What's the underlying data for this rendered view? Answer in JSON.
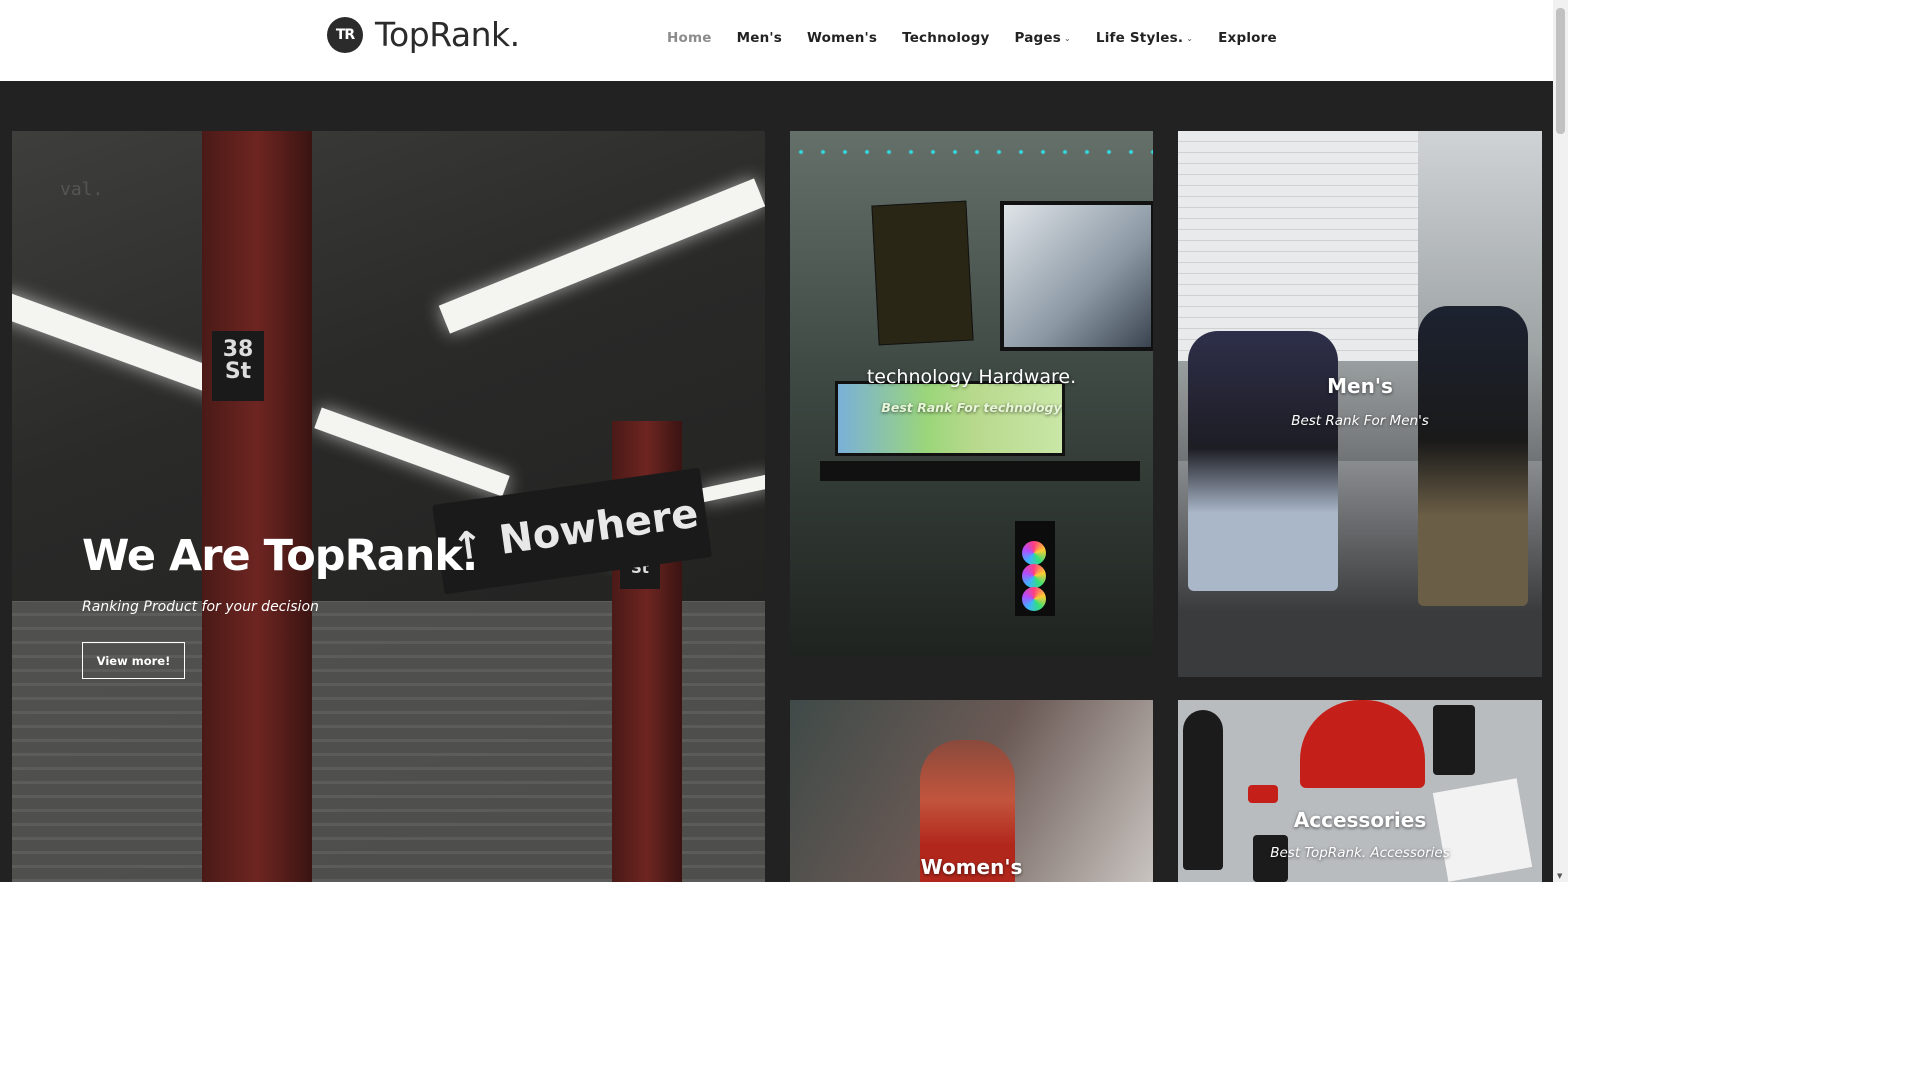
{
  "brand": {
    "logo_mark": "TR",
    "name": "TopRank."
  },
  "nav": {
    "items": [
      {
        "label": "Home",
        "active": true,
        "dropdown": false
      },
      {
        "label": "Men's",
        "active": false,
        "dropdown": false
      },
      {
        "label": "Women's",
        "active": false,
        "dropdown": false
      },
      {
        "label": "Technology",
        "active": false,
        "dropdown": false
      },
      {
        "label": "Pages",
        "active": false,
        "dropdown": true
      },
      {
        "label": "Life Styles.",
        "active": false,
        "dropdown": true
      },
      {
        "label": "Explore",
        "active": false,
        "dropdown": false
      }
    ]
  },
  "hero": {
    "title": "We Are TopRank.",
    "subtitle": "Ranking Product for your decision",
    "button_label": "View more!",
    "scene_sign": "Nowhere",
    "scene_plate_1": "38\nSt",
    "scene_plate_2": "38\nSt",
    "scene_text": "val."
  },
  "cards": {
    "technology": {
      "title": "technology Hardware.",
      "subtitle": "Best Rank For technology"
    },
    "mens": {
      "title": "Men's",
      "subtitle": "Best Rank For Men's"
    },
    "womens": {
      "title": "Women's"
    },
    "accessories": {
      "title": "Accessories",
      "subtitle": "Best TopRank. Accessories"
    }
  },
  "colors": {
    "header_bg": "#ffffff",
    "page_bg": "#222222",
    "nav_active": "#8c8c8c",
    "nav_text": "#222222"
  }
}
